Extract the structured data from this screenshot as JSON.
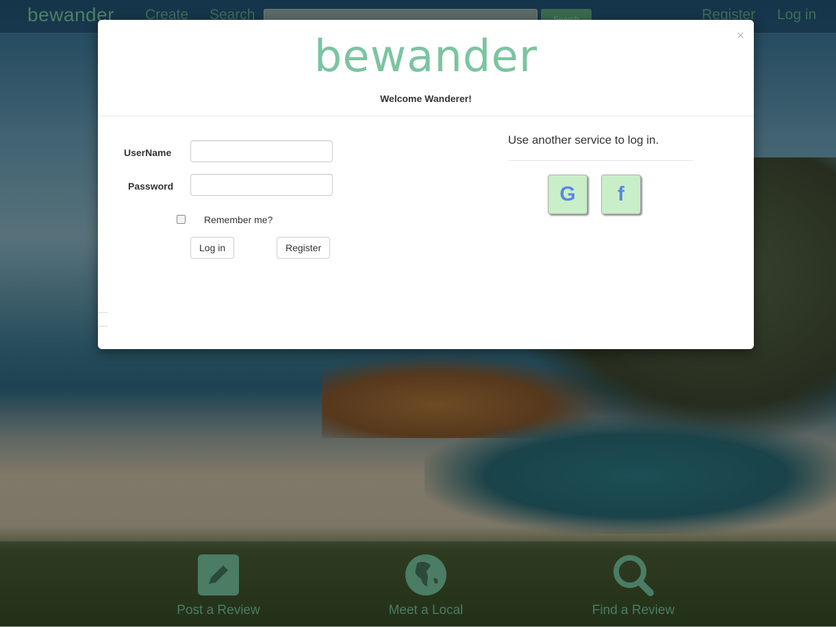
{
  "navbar": {
    "brand": "bewander",
    "links": {
      "create": "Create",
      "search": "Search",
      "register": "Register",
      "login": "Log in"
    },
    "search_button": "Search"
  },
  "features": [
    {
      "label": "Post a Review",
      "icon": "pencil-square-icon"
    },
    {
      "label": "Meet a Local",
      "icon": "globe-icon"
    },
    {
      "label": "Find a Review",
      "icon": "magnifier-icon"
    }
  ],
  "modal": {
    "close": "×",
    "logo": "bewander",
    "welcome": "Welcome Wanderer!",
    "form": {
      "username_label": "UserName",
      "username_value": "",
      "password_label": "Password",
      "password_value": "",
      "remember_label": "Remember me?",
      "login_button": "Log in",
      "register_button": "Register"
    },
    "external": {
      "title": "Use another service to log in.",
      "google": "G",
      "facebook": "f"
    }
  },
  "colors": {
    "brand_green": "#7cc4a0",
    "external_button_bg": "#c8efc8",
    "external_icon": "#5b86e8"
  }
}
